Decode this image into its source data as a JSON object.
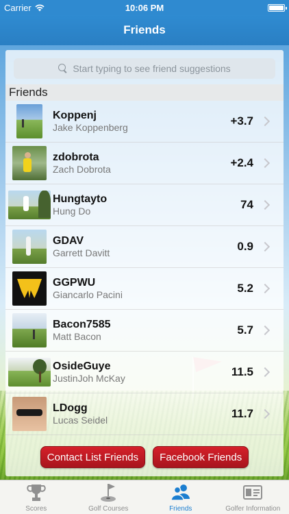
{
  "status_bar": {
    "carrier": "Carrier",
    "time": "10:06 PM"
  },
  "nav": {
    "title": "Friends"
  },
  "search": {
    "placeholder": "Start typing to see friend suggestions"
  },
  "section": {
    "title": "Friends"
  },
  "friends": [
    {
      "username": "Koppenj",
      "fullname": "Jake Koppenberg",
      "handicap": "+3.7",
      "avatar": "course-photo"
    },
    {
      "username": "zdobrota",
      "fullname": "Zach Dobrota",
      "handicap": "+2.4",
      "avatar": "golfer-photo"
    },
    {
      "username": "Hungtayto",
      "fullname": "Hung Do",
      "handicap": "74",
      "avatar": "swing-photo"
    },
    {
      "username": "GDAV",
      "fullname": "Garrett Davitt",
      "handicap": "0.9",
      "avatar": "golfer-photo"
    },
    {
      "username": "GGPWU",
      "fullname": "Giancarlo Pacini",
      "handicap": "5.2",
      "avatar": "wu-logo"
    },
    {
      "username": "Bacon7585",
      "fullname": "Matt Bacon",
      "handicap": "5.7",
      "avatar": "course-photo"
    },
    {
      "username": "OsideGuye",
      "fullname": "JustinJoh McKay",
      "handicap": "11.5",
      "avatar": "tree-photo"
    },
    {
      "username": "LDogg",
      "fullname": "Lucas Seidel",
      "handicap": "11.7",
      "avatar": "baby-photo"
    }
  ],
  "buttons": {
    "contacts": "Contact List Friends",
    "facebook": "Facebook Friends"
  },
  "tabs": [
    {
      "label": "Scores",
      "icon": "trophy-icon",
      "active": false
    },
    {
      "label": "Golf Courses",
      "icon": "flag-hole-icon",
      "active": false
    },
    {
      "label": "Friends",
      "icon": "people-icon",
      "active": true
    },
    {
      "label": "Golfer Information",
      "icon": "id-card-icon",
      "active": false
    }
  ],
  "colors": {
    "nav": "#2f8bd1",
    "button_red": "#c41b24",
    "tab_active": "#1b7ed0"
  }
}
